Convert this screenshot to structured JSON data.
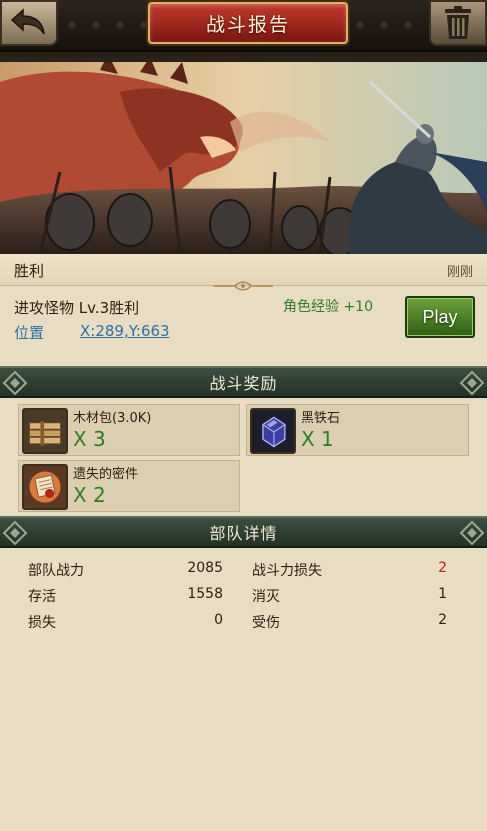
{
  "header": {
    "title": "战斗报告",
    "back_icon": "back-arrow-icon",
    "trash_icon": "trash-icon"
  },
  "summary": {
    "result": "胜利",
    "time": "刚刚",
    "attack_text": "进攻怪物 Lv.3胜利",
    "exp_text": "角色经验 +10",
    "play_label": "Play",
    "position_label": "位置",
    "position_value": "X:289,Y:663"
  },
  "rewards": {
    "title": "战斗奖励",
    "items": [
      {
        "name": "木材包(3.0K)",
        "qty": "X 3",
        "icon": "wood-bundle-icon"
      },
      {
        "name": "黑铁石",
        "qty": "X 1",
        "icon": "black-iron-ore-icon"
      },
      {
        "name": "遗失的密件",
        "qty": "X 2",
        "icon": "lost-secret-document-icon"
      }
    ]
  },
  "troops": {
    "title": "部队详情",
    "stats": [
      {
        "label": "部队战力",
        "value": "2085"
      },
      {
        "label": "战斗力损失",
        "value": "2"
      },
      {
        "label": "存活",
        "value": "1558"
      },
      {
        "label": "消灭",
        "value": "1"
      },
      {
        "label": "损失",
        "value": "0"
      },
      {
        "label": "受伤",
        "value": "2"
      }
    ]
  },
  "colors": {
    "positive": "#2f7d22",
    "link": "#2f6fa8",
    "loss": "#b3231a"
  }
}
